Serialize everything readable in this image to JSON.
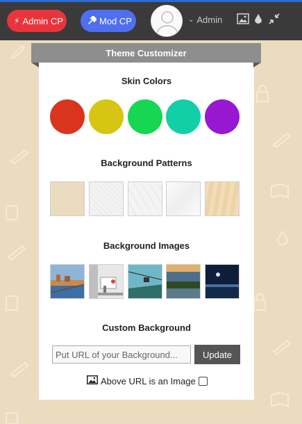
{
  "topbar": {
    "admin_cp_label": "Admin CP",
    "mod_cp_label": "Mod CP",
    "user_name": "Admin",
    "accent_color": "#2a6bd6"
  },
  "customizer": {
    "title": "Theme Customizer",
    "skin_colors": {
      "heading": "Skin Colors",
      "colors": [
        "#d9341e",
        "#d6c512",
        "#17d651",
        "#12cfa8",
        "#9718d0"
      ]
    },
    "background_patterns": {
      "heading": "Background Patterns"
    },
    "background_images": {
      "heading": "Background Images"
    },
    "custom_background": {
      "heading": "Custom Background",
      "url_placeholder": "Put URL of your Background...",
      "update_label": "Update",
      "is_image_label": "Above URL is an Image",
      "is_image_checked": false
    }
  }
}
